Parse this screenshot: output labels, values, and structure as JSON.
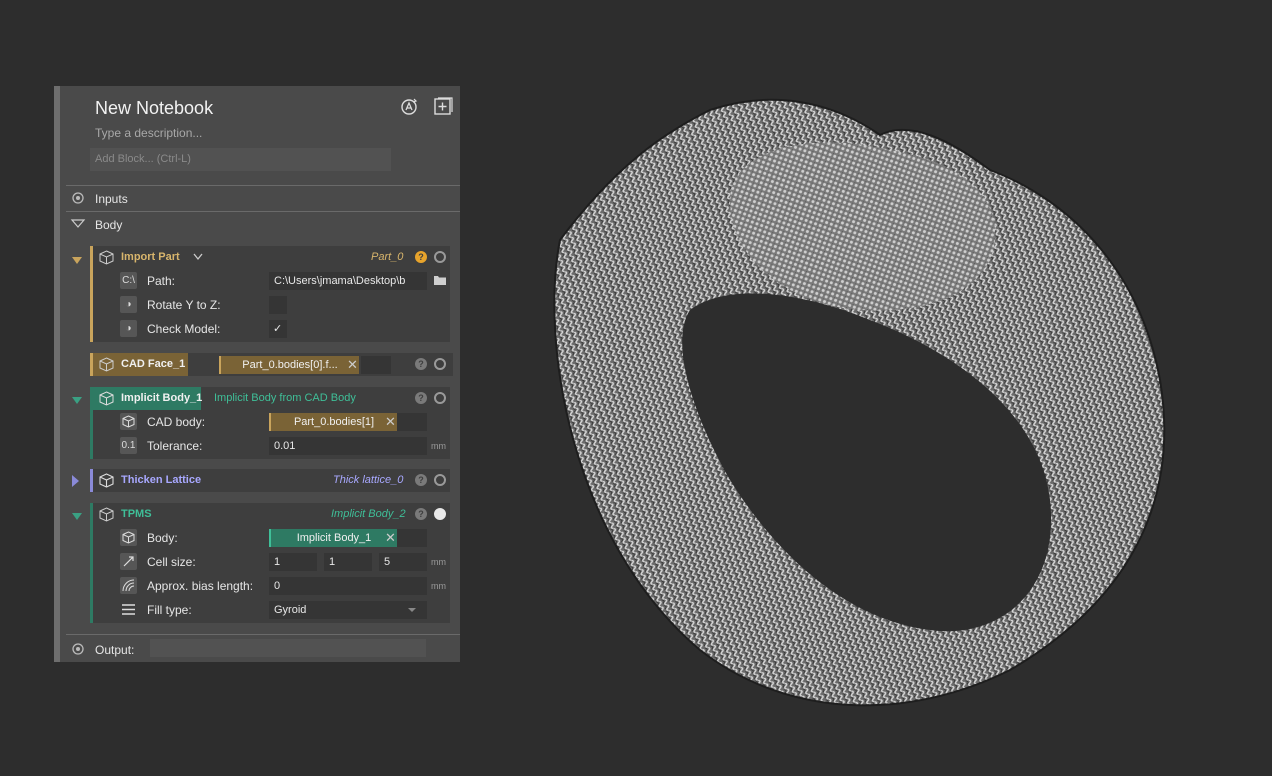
{
  "notebook": {
    "title": "New Notebook",
    "description_placeholder": "Type a description...",
    "add_block_placeholder": "Add Block... (Ctrl-L)"
  },
  "sections": {
    "inputs": "Inputs",
    "body": "Body",
    "output": "Output:"
  },
  "blocks": {
    "import_part": {
      "name": "Import Part",
      "tag": "Part_0",
      "help": "?",
      "path_label": "Path:",
      "path_icon": "C:\\",
      "path_value": "C:\\Users\\jmama\\Desktop\\b",
      "rotate_label": "Rotate Y to Z:",
      "check_label": "Check Model:",
      "check_value": "✓"
    },
    "cad_face": {
      "name": "CAD Face_1",
      "chip": "Part_0.bodies[0].f...",
      "help": "?"
    },
    "implicit_body": {
      "name": "Implicit Body_1",
      "subtitle": "Implicit Body from CAD Body",
      "help": "?",
      "cad_label": "CAD body:",
      "cad_chip": "Part_0.bodies[1]",
      "tol_label": "Tolerance:",
      "tol_icon": "0.1",
      "tol_value": "0.01",
      "unit": "mm"
    },
    "thicken": {
      "name": "Thicken Lattice",
      "tag": "Thick lattice_0",
      "help": "?"
    },
    "tpms": {
      "name": "TPMS",
      "tag": "Implicit Body_2",
      "help": "?",
      "body_label": "Body:",
      "body_chip": "Implicit Body_1",
      "cell_label": "Cell size:",
      "cell_x": "1",
      "cell_y": "1",
      "cell_z": "5",
      "bias_label": "Approx. bias length:",
      "bias_value": "0",
      "fill_label": "Fill type:",
      "fill_value": "Gyroid",
      "unit": "mm"
    }
  },
  "colors": {
    "import_accent": "#c9a45c",
    "implicit_accent": "#2e7a63",
    "thicken_accent": "#8a8ad8",
    "background": "#2d2d2d"
  }
}
